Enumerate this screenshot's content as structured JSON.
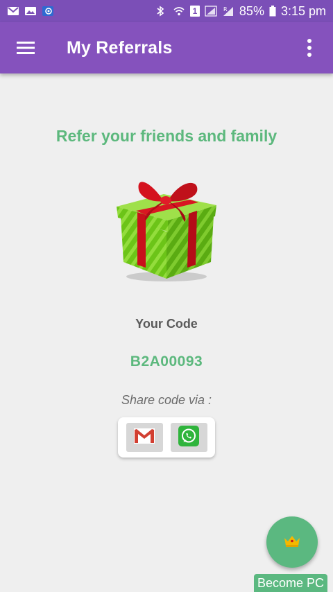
{
  "status_bar": {
    "battery": "85%",
    "time": "3:15 pm",
    "sim_badge": "1",
    "icons": [
      "gmail-icon",
      "gallery-icon",
      "app-notification-icon",
      "bluetooth-icon",
      "wifi-icon",
      "sim-icon",
      "signal-icon",
      "signal-roaming-icon",
      "battery-icon"
    ]
  },
  "app_bar": {
    "title": "My Referrals",
    "menu_icon": "hamburger-menu-icon",
    "more_icon": "more-vert-icon"
  },
  "main": {
    "headline": "Refer your friends and family",
    "gift_icon": "gift-box-icon",
    "your_code_label": "Your Code",
    "code": "B2A00093",
    "share_label": "Share code via :",
    "share_options": [
      {
        "icon": "gmail-icon"
      },
      {
        "icon": "whatsapp-icon"
      }
    ]
  },
  "fab": {
    "icon": "crown-icon",
    "label": "Become PC"
  },
  "colors": {
    "primary": "#8552bd",
    "status_bar": "#7b4fb7",
    "accent": "#5cb87d",
    "background": "#efefef"
  }
}
